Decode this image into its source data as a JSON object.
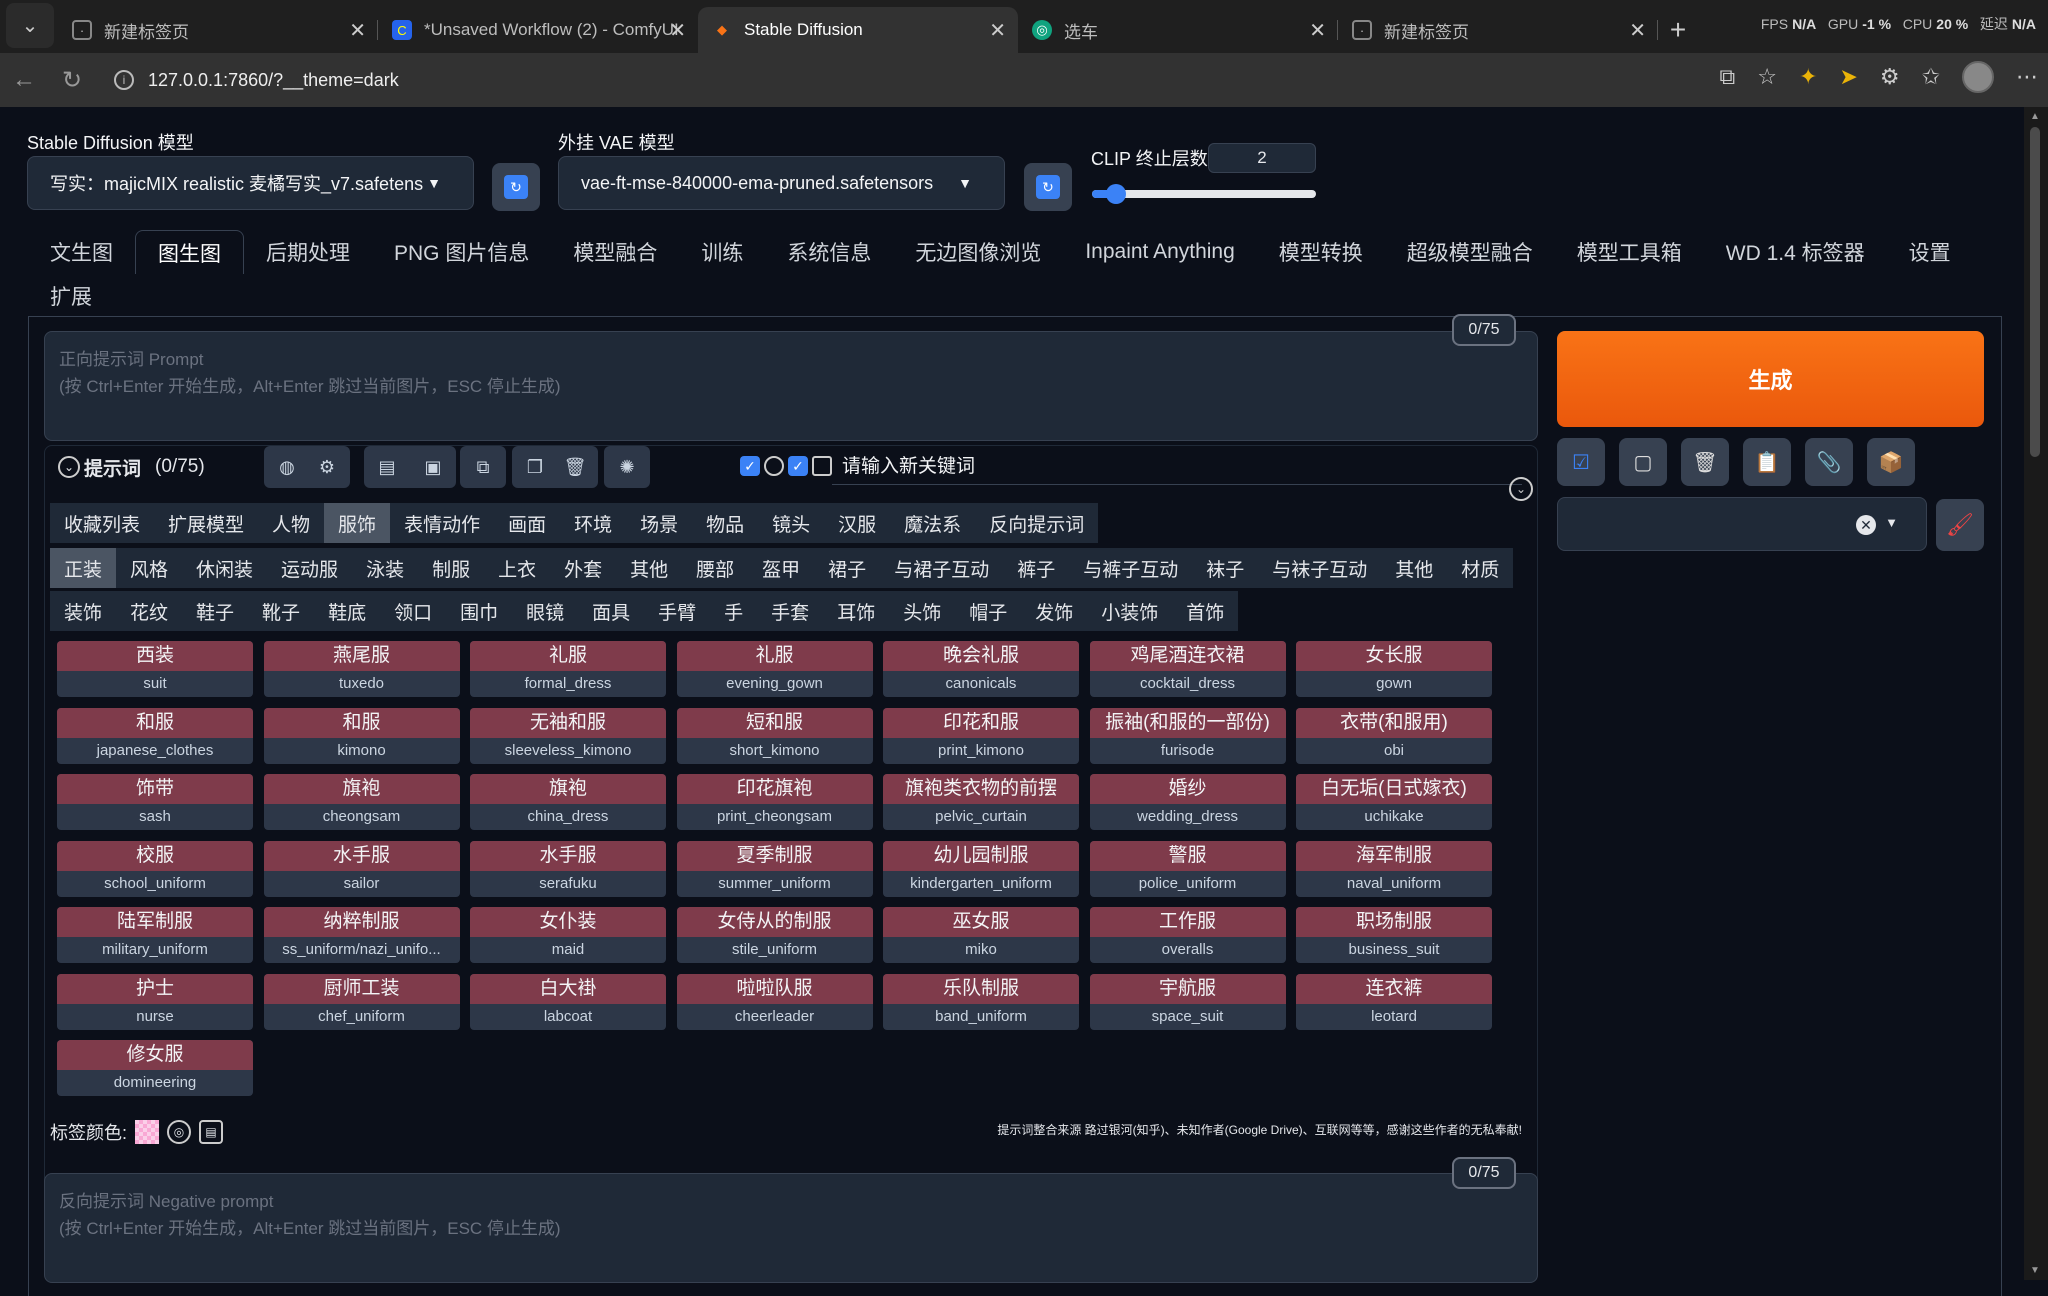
{
  "browser": {
    "tabs": [
      {
        "title": "新建标签页",
        "active": false
      },
      {
        "title": "*Unsaved Workflow (2) - ComfyUI",
        "active": false
      },
      {
        "title": "Stable Diffusion",
        "active": true
      },
      {
        "title": "选车",
        "active": false
      },
      {
        "title": "新建标签页",
        "active": false
      }
    ],
    "perf": {
      "fps_label": "FPS",
      "fps_value": "N/A",
      "gpu_label": "GPU",
      "gpu_value": "-1 %",
      "cpu_label": "CPU",
      "cpu_value": "20 %",
      "latency_label": "延迟",
      "latency_value": "N/A"
    },
    "url": "127.0.0.1:7860/?__theme=dark"
  },
  "top": {
    "model_label": "Stable Diffusion 模型",
    "model_value": "写实：majicMIX realistic 麦橘写实_v7.safetens",
    "vae_label": "外挂 VAE 模型",
    "vae_value": "vae-ft-mse-840000-ema-pruned.safetensors",
    "clip_label": "CLIP 终止层数",
    "clip_value": "2"
  },
  "main_tabs": [
    "文生图",
    "图生图",
    "后期处理",
    "PNG 图片信息",
    "模型融合",
    "训练",
    "系统信息",
    "无边图像浏览",
    "Inpaint Anything",
    "模型转换",
    "超级模型融合",
    "模型工具箱",
    "WD 1.4 标签器",
    "设置",
    "扩展"
  ],
  "active_main_tab": "图生图",
  "prompt": {
    "placeholder_line1": "正向提示词 Prompt",
    "placeholder_line2": "(按 Ctrl+Enter 开始生成，Alt+Enter 跳过当前图片，ESC 停止生成)",
    "counter": "0/75"
  },
  "generate_label": "生成",
  "tag_panel": {
    "title": "提示词",
    "count": "(0/75)",
    "keyword_placeholder": "请输入新关键词",
    "category_tabs": [
      "收藏列表",
      "扩展模型",
      "人物",
      "服饰",
      "表情动作",
      "画面",
      "环境",
      "场景",
      "物品",
      "镜头",
      "汉服",
      "魔法系",
      "反向提示词"
    ],
    "active_category": "服饰",
    "sub_tabs_row1": [
      "正装",
      "风格",
      "休闲装",
      "运动服",
      "泳装",
      "制服",
      "上衣",
      "外套",
      "其他",
      "腰部",
      "盔甲",
      "裙子",
      "与裙子互动",
      "裤子",
      "与裤子互动",
      "袜子",
      "与袜子互动",
      "其他",
      "材质"
    ],
    "sub_tabs_row2": [
      "装饰",
      "花纹",
      "鞋子",
      "靴子",
      "鞋底",
      "领口",
      "围巾",
      "眼镜",
      "面具",
      "手臂",
      "手",
      "手套",
      "耳饰",
      "头饰",
      "帽子",
      "发饰",
      "小装饰",
      "首饰"
    ],
    "tags": [
      {
        "cn": "西装",
        "en": "suit"
      },
      {
        "cn": "燕尾服",
        "en": "tuxedo"
      },
      {
        "cn": "礼服",
        "en": "formal_dress"
      },
      {
        "cn": "礼服",
        "en": "evening_gown"
      },
      {
        "cn": "晚会礼服",
        "en": "canonicals"
      },
      {
        "cn": "鸡尾酒连衣裙",
        "en": "cocktail_dress"
      },
      {
        "cn": "女长服",
        "en": "gown"
      },
      {
        "cn": "和服",
        "en": "japanese_clothes"
      },
      {
        "cn": "和服",
        "en": "kimono"
      },
      {
        "cn": "无袖和服",
        "en": "sleeveless_kimono"
      },
      {
        "cn": "短和服",
        "en": "short_kimono"
      },
      {
        "cn": "印花和服",
        "en": "print_kimono"
      },
      {
        "cn": "振袖(和服的一部份)",
        "en": "furisode"
      },
      {
        "cn": "衣带(和服用)",
        "en": "obi"
      },
      {
        "cn": "饰带",
        "en": "sash"
      },
      {
        "cn": "旗袍",
        "en": "cheongsam"
      },
      {
        "cn": "旗袍",
        "en": "china_dress"
      },
      {
        "cn": "印花旗袍",
        "en": "print_cheongsam"
      },
      {
        "cn": "旗袍类衣物的前摆",
        "en": "pelvic_curtain"
      },
      {
        "cn": "婚纱",
        "en": "wedding_dress"
      },
      {
        "cn": "白无垢(日式嫁衣)",
        "en": "uchikake"
      },
      {
        "cn": "校服",
        "en": "school_uniform"
      },
      {
        "cn": "水手服",
        "en": "sailor"
      },
      {
        "cn": "水手服",
        "en": "serafuku"
      },
      {
        "cn": "夏季制服",
        "en": "summer_uniform"
      },
      {
        "cn": "幼儿园制服",
        "en": "kindergarten_uniform"
      },
      {
        "cn": "警服",
        "en": "police_uniform"
      },
      {
        "cn": "海军制服",
        "en": "naval_uniform"
      },
      {
        "cn": "陆军制服",
        "en": "military_uniform"
      },
      {
        "cn": "纳粹制服",
        "en": "ss_uniform/nazi_unifo..."
      },
      {
        "cn": "女仆装",
        "en": "maid"
      },
      {
        "cn": "女侍从的制服",
        "en": "stile_uniform"
      },
      {
        "cn": "巫女服",
        "en": "miko"
      },
      {
        "cn": "工作服",
        "en": "overalls"
      },
      {
        "cn": "职场制服",
        "en": "business_suit"
      },
      {
        "cn": "护士",
        "en": "nurse"
      },
      {
        "cn": "厨师工装",
        "en": "chef_uniform"
      },
      {
        "cn": "白大褂",
        "en": "labcoat"
      },
      {
        "cn": "啦啦队服",
        "en": "cheerleader"
      },
      {
        "cn": "乐队制服",
        "en": "band_uniform"
      },
      {
        "cn": "宇航服",
        "en": "space_suit"
      },
      {
        "cn": "连衣裤",
        "en": "leotard"
      },
      {
        "cn": "修女服",
        "en": "domineering"
      }
    ],
    "color_label": "标签颜色:",
    "credit": "提示词整合来源 路过银河(知乎)、未知作者(Google Drive)、互联网等等，感谢这些作者的无私奉献!"
  },
  "negative": {
    "placeholder_line1": "反向提示词 Negative prompt",
    "placeholder_line2": "(按 Ctrl+Enter 开始生成，Alt+Enter 跳过当前图片，ESC 停止生成)",
    "counter": "0/75"
  }
}
